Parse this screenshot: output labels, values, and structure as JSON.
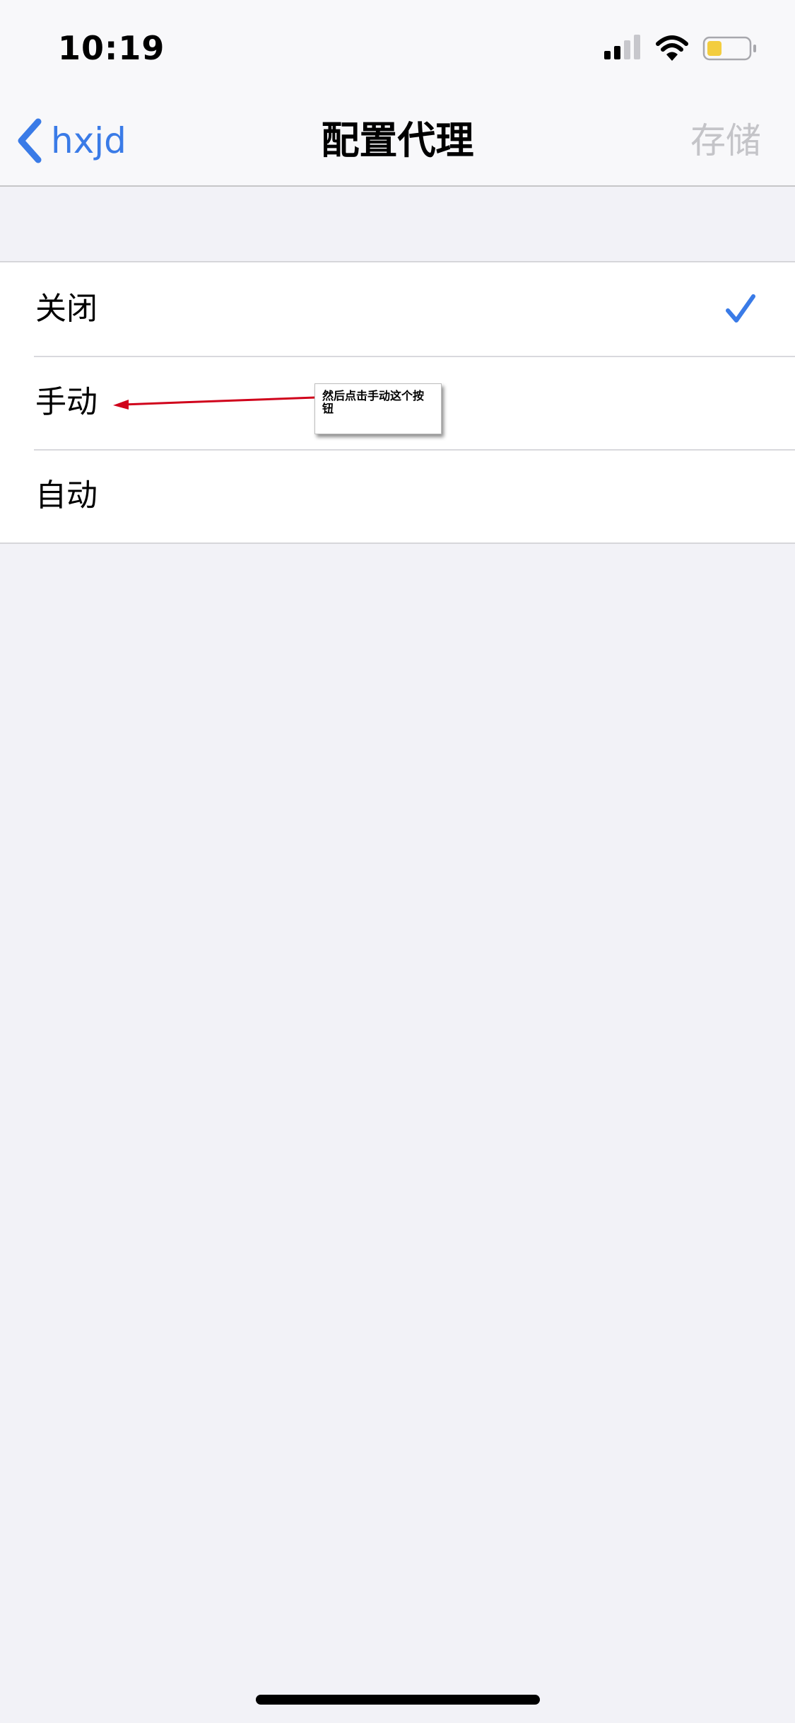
{
  "status_bar": {
    "time": "10:19",
    "icons": [
      "cellular-signal-icon",
      "wifi-icon",
      "battery-icon"
    ],
    "battery_color": "#f3cd3f"
  },
  "nav": {
    "back_label": "hxjd",
    "title": "配置代理",
    "save_label": "存储",
    "accent_color": "#3a7be7",
    "save_disabled_color": "#c4c4c8"
  },
  "options": [
    {
      "label": "关闭",
      "selected": true
    },
    {
      "label": "手动",
      "selected": false
    },
    {
      "label": "自动",
      "selected": false
    }
  ],
  "annotation": {
    "text": "然后点击手动这个按钮",
    "arrow_color": "#d0021b"
  }
}
